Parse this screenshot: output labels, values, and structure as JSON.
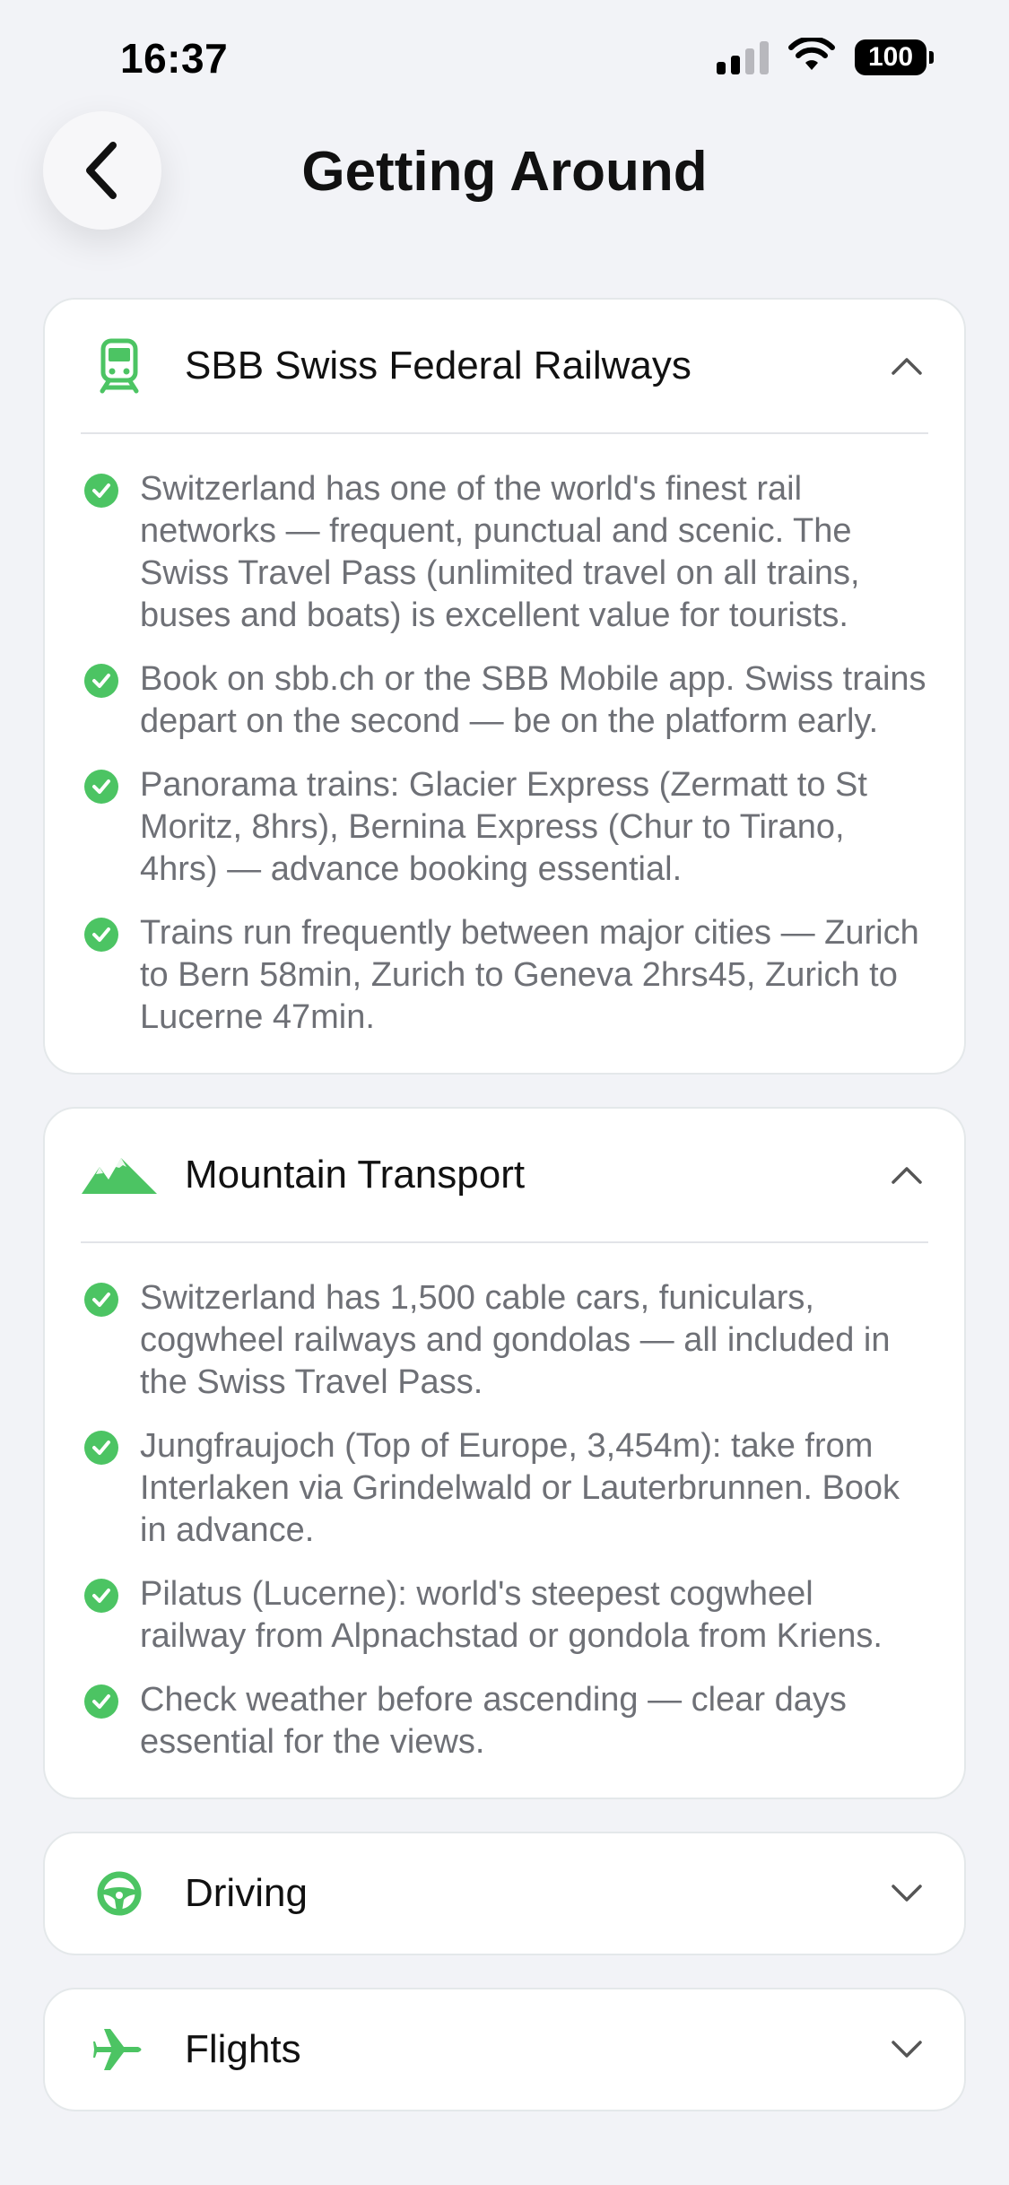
{
  "status_bar": {
    "time": "16:37",
    "battery": "100"
  },
  "header": {
    "title": "Getting Around"
  },
  "colors": {
    "accent": "#4cc463",
    "background": "#f2f3f7",
    "card": "#ffffff",
    "body_text": "#6e7076"
  },
  "sections": [
    {
      "title": "SBB Swiss Federal Railways",
      "icon": "train-icon",
      "expanded": true,
      "items": [
        "Switzerland has one of the world's finest rail networks — frequent, punctual and scenic. The Swiss Travel Pass (unlimited travel on all trains, buses and boats) is excellent value for tourists.",
        "Book on sbb.ch or the SBB Mobile app. Swiss trains depart on the second — be on the platform early.",
        "Panorama trains: Glacier Express (Zermatt to St Moritz, 8hrs), Bernina Express (Chur to Tirano, 4hrs) — advance booking essential.",
        "Trains run frequently between major cities — Zurich to Bern 58min, Zurich to Geneva 2hrs45, Zurich to Lucerne 47min."
      ]
    },
    {
      "title": "Mountain Transport",
      "icon": "mountain-icon",
      "expanded": true,
      "items": [
        "Switzerland has 1,500 cable cars, funiculars, cogwheel railways and gondolas — all included in the Swiss Travel Pass.",
        "Jungfraujoch (Top of Europe, 3,454m): take from Interlaken via Grindelwald or Lauterbrunnen. Book in advance.",
        "Pilatus (Lucerne): world's steepest cogwheel railway from Alpnachstad or gondola from Kriens.",
        "Check weather before ascending — clear days essential for the views."
      ]
    },
    {
      "title": "Driving",
      "icon": "steering-wheel-icon",
      "expanded": false,
      "items": []
    },
    {
      "title": "Flights",
      "icon": "airplane-icon",
      "expanded": false,
      "items": []
    }
  ]
}
